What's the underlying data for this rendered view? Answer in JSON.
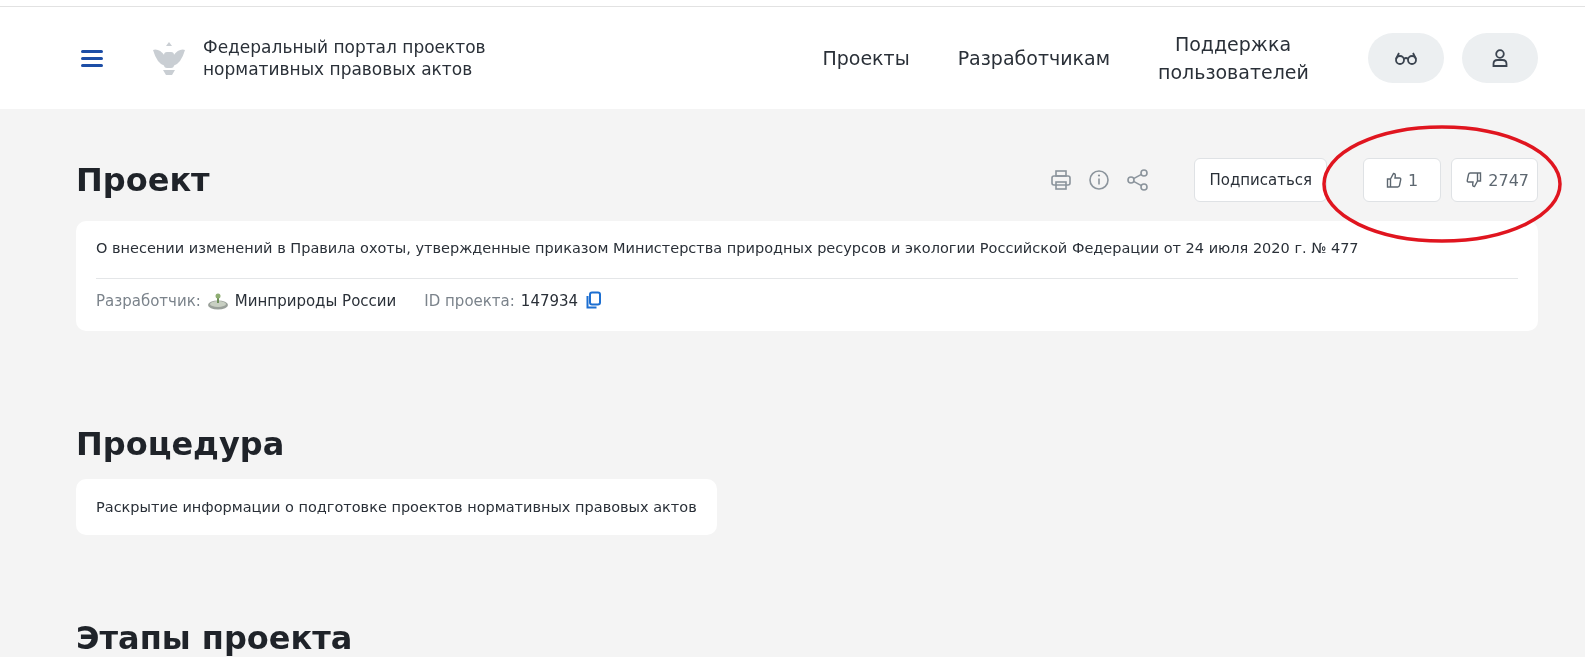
{
  "header": {
    "site_title": "Федеральный портал проектов нормативных правовых актов",
    "nav": [
      "Проекты",
      "Разработчикам",
      "Поддержка пользователей"
    ]
  },
  "project": {
    "heading": "Проект",
    "subscribe": "Подписаться",
    "likes": "1",
    "dislikes": "2747",
    "title": "О внесении изменений в Правила охоты, утвержденные приказом Министерства природных ресурсов и экологии Российской Федерации от 24 июля 2020 г. № 477",
    "developer_label": "Разработчик:",
    "developer": "Минприроды России",
    "id_label": "ID проекта:",
    "id": "147934"
  },
  "procedure": {
    "heading": "Процедура",
    "text": "Раскрытие информации о подготовке проектов нормативных правовых актов"
  },
  "stages": {
    "heading": "Этапы проекта"
  }
}
